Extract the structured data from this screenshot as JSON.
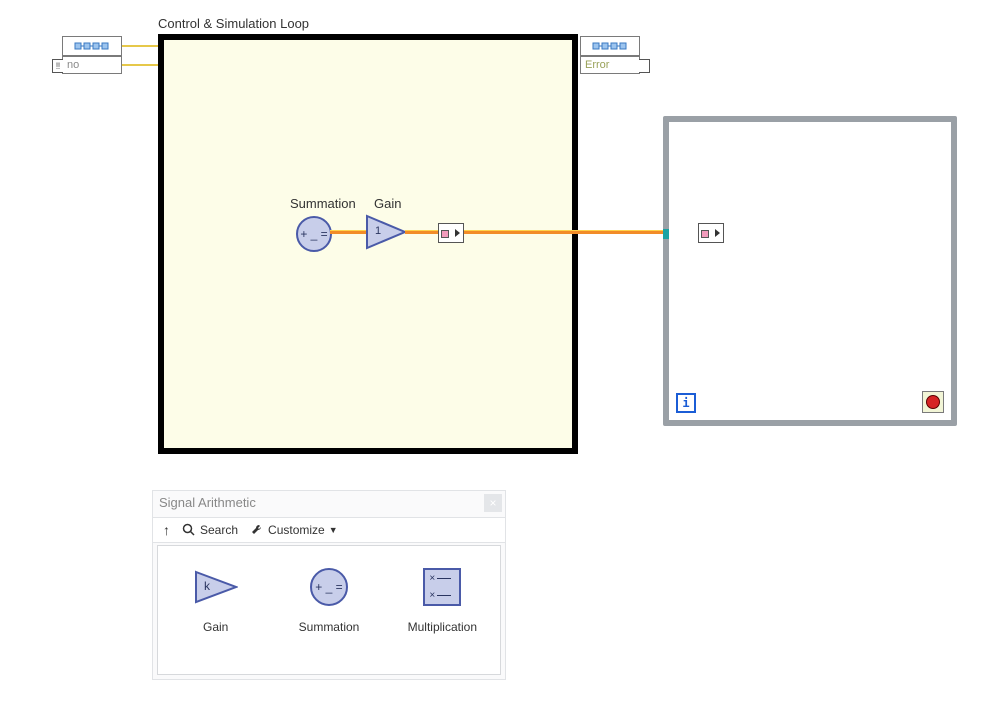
{
  "simulation_loop": {
    "title": "Control & Simulation Loop",
    "left_terminal_label": "no",
    "right_terminal_label": "Error",
    "nodes": {
      "summation": {
        "label": "Summation",
        "glyph": "+ _ ="
      },
      "gain": {
        "label": "Gain",
        "value": "1"
      }
    }
  },
  "while_loop": {
    "iteration_glyph": "i"
  },
  "palette": {
    "title": "Signal Arithmetic",
    "toolbar": {
      "nav_up": "↑",
      "search_label": "Search",
      "customize_label": "Customize"
    },
    "items": [
      {
        "name": "Gain",
        "gain_k": "k"
      },
      {
        "name": "Summation",
        "glyph": "+ _ ="
      },
      {
        "name": "Multiplication"
      }
    ]
  }
}
